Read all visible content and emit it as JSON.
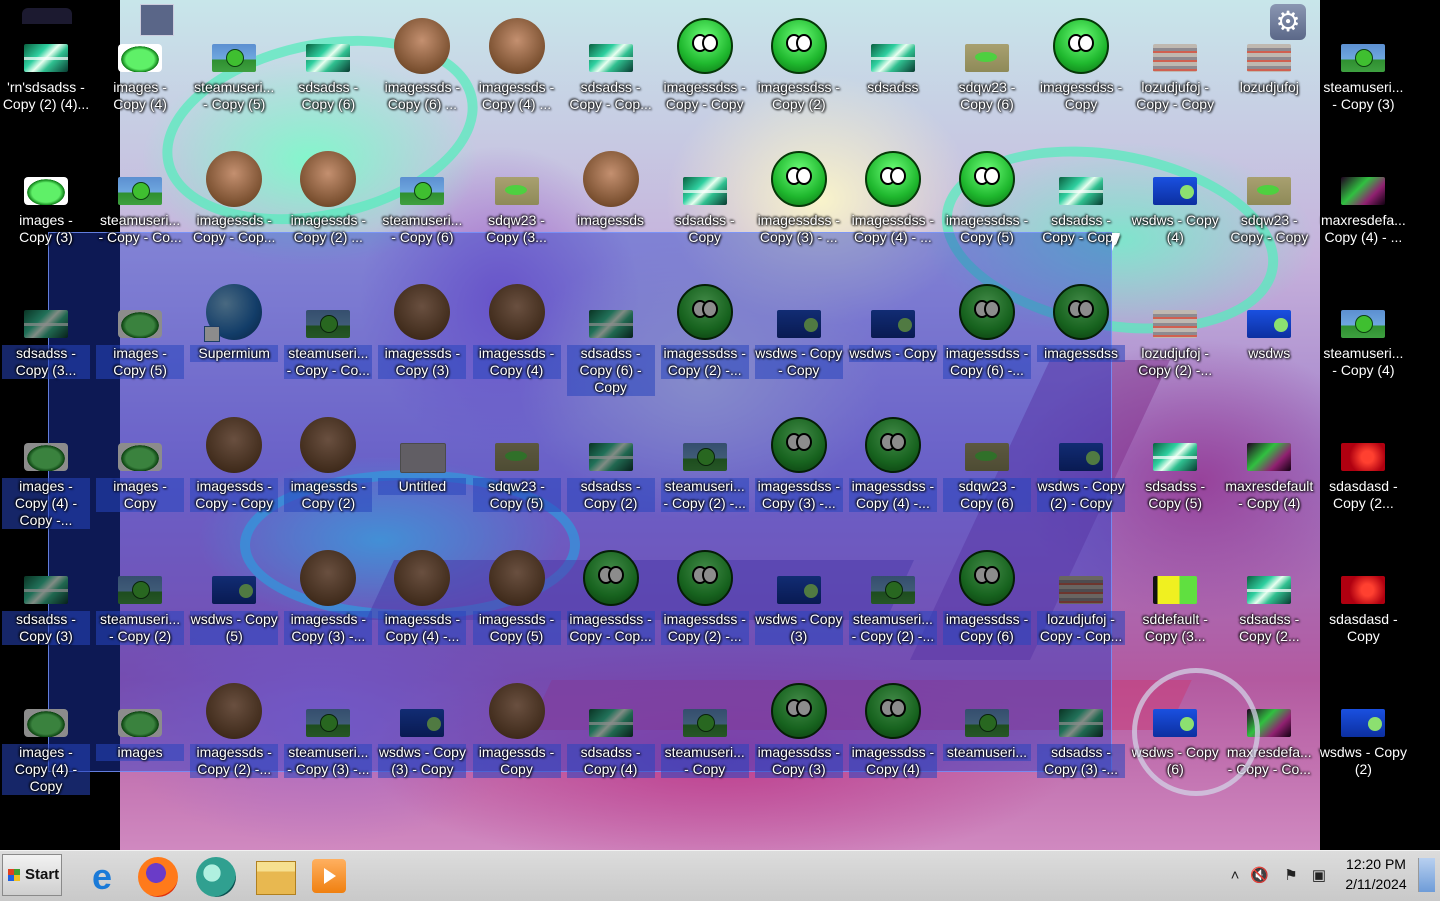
{
  "taskbar": {
    "start_label": "Start",
    "apps": [
      "internet-explorer-icon",
      "firefox-icon",
      "supermium-icon",
      "file-explorer-icon",
      "media-player-icon"
    ],
    "clock_time": "12:20 PM",
    "clock_date": "2/11/2024"
  },
  "desktop": {
    "icons": [
      "'rn'sdsadss - Copy (2) (4)...",
      "images - Copy (4)",
      "steamuseri... - Copy (5)",
      "sdsadss - Copy (6)",
      "imagessds - Copy (6) ...",
      "imagessds - Copy (4) ...",
      "sdsadss - Copy - Cop...",
      "imagessdss - Copy - Copy",
      "imagessdss - Copy (2)",
      "sdsadss",
      "sdqw23 - Copy (6)",
      "imagessdss - Copy",
      "lozudjufoj - Copy - Copy",
      "lozudjufoj",
      "steamuseri... - Copy (3)",
      "images - Copy (3)",
      "steamuseri... - Copy - Co...",
      "imagessds - Copy - Cop...",
      "imagessds - Copy (2) ...",
      "steamuseri... - Copy (6)",
      "sdqw23 - Copy (3...",
      "imagessds",
      "sdsadss - Copy",
      "imagessdss - Copy (3) - ...",
      "imagessdss - Copy (4) - ...",
      "imagessdss - Copy (5)",
      "sdsadss - Copy - Copy",
      "wsdws - Copy (4)",
      "sdqw23 - Copy - Copy",
      "maxresdefa... Copy (4) - ...",
      "sdsadss - Copy (3...",
      "images - Copy (5)",
      "Supermium",
      "steamuseri... - Copy - Co...",
      "imagessds - Copy (3)",
      "imagessds - Copy (4)",
      "sdsadss - Copy (6) - Copy",
      "imagessdss - Copy (2) -...",
      "wsdws - Copy - Copy",
      "wsdws - Copy",
      "imagessdss - Copy (6) -...",
      "imagessdss",
      "lozudjufoj - Copy (2) -...",
      "wsdws",
      "steamuseri... - Copy (4)",
      "images - Copy (4) - Copy -...",
      "images - Copy",
      "imagessds - Copy - Copy",
      "imagessds - Copy (2)",
      "Untitled",
      "sdqw23 - Copy (5)",
      "sdsadss - Copy (2)",
      "steamuseri... - Copy (2) -...",
      "imagessdss - Copy (3) -...",
      "imagessdss - Copy (4) -...",
      "sdqw23 - Copy (6)",
      "wsdws - Copy (2) - Copy",
      "sdsadss - Copy (5)",
      "maxresdefault - Copy (4)",
      "sdasdasd - Copy (2...",
      "sdsadss - Copy (3)",
      "steamuseri... - Copy (2)",
      "wsdws - Copy (5)",
      "imagessds - Copy (3) -...",
      "imagessds - Copy (4) -...",
      "imagessds - Copy (5)",
      "imagessdss - Copy - Cop...",
      "imagessdss - Copy (2) -...",
      "wsdws - Copy (3)",
      "steamuseri... - Copy (2) -...",
      "imagessdss - Copy (6)",
      "lozudjufoj - Copy - Cop...",
      "sddefault - Copy (3...",
      "sdsadss - Copy (2...",
      "sdasdasd - Copy",
      "images - Copy (4) - Copy",
      "images",
      "imagessds - Copy (2) -...",
      "steamuseri... - Copy (3) -...",
      "wsdws - Copy (3) - Copy",
      "imagessds - Copy",
      "sdsadss - Copy (4)",
      "steamuseri... - Copy",
      "imagessdss - Copy (3)",
      "imagessdss - Copy (4)",
      "steamuseri...",
      "sdsadss - Copy (3) -...",
      "wsdws - Copy (6)",
      "maxresdefa... - Copy - Co...",
      "wsdws - Copy (2)"
    ]
  }
}
